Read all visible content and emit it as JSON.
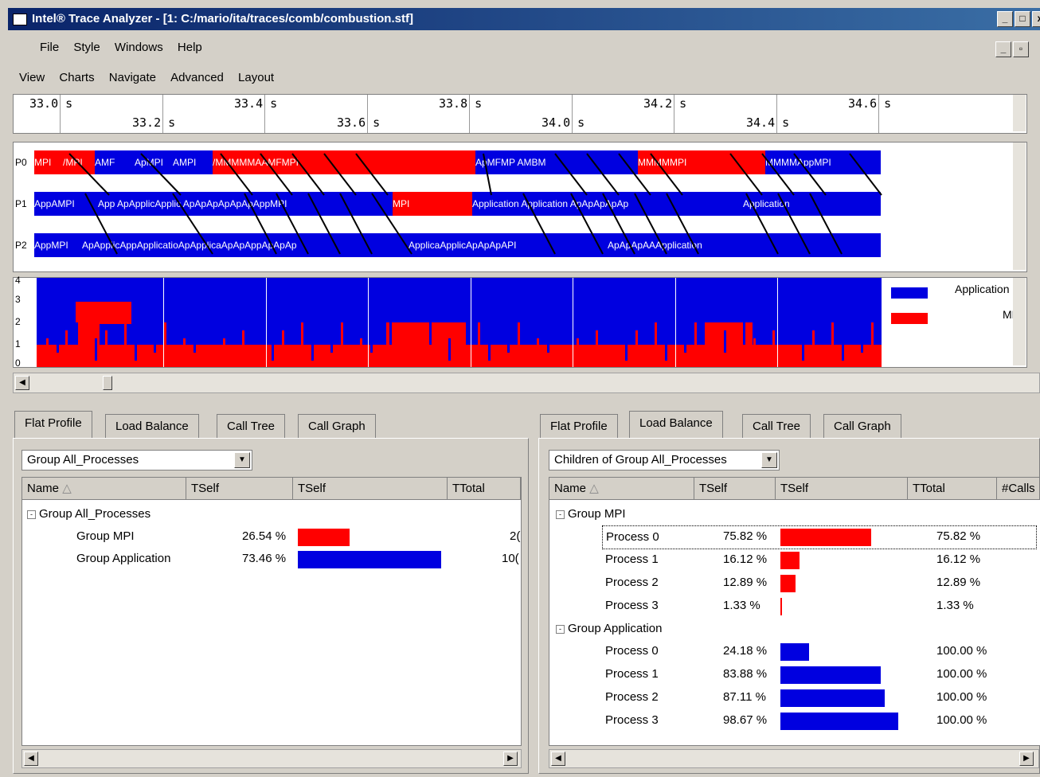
{
  "window": {
    "title": "Intel® Trace Analyzer - [1: C:/mario/ita/traces/comb/combustion.stf]"
  },
  "menu1": [
    "File",
    "Style",
    "Windows",
    "Help"
  ],
  "menu2": [
    "View",
    "Charts",
    "Navigate",
    "Advanced",
    "Layout"
  ],
  "ruler": {
    "top": [
      "33.0 s",
      "33.4 s",
      "33.8 s",
      "34.2 s",
      "34.6 s"
    ],
    "bottom": [
      "33.2 s",
      "33.6 s",
      "34.0 s",
      "34.4 s"
    ]
  },
  "timeline": {
    "processes": [
      "P0",
      "P1",
      "P2"
    ],
    "p0_segments": [
      {
        "t": "MPI",
        "c": "red"
      },
      {
        "t": "/MPI",
        "c": "red"
      },
      {
        "t": "AMF",
        "c": "blue"
      },
      {
        "t": "ApMPI",
        "c": "blue"
      },
      {
        "t": "AMPI",
        "c": "blue"
      },
      {
        "t": "/MMMMMAAMFMPI",
        "c": "red"
      },
      {
        "t": "ApMFMP AMBM",
        "c": "blue"
      },
      {
        "t": "MMMMMPI",
        "c": "red"
      },
      {
        "t": "MMMMAppMPI",
        "c": "blue"
      }
    ],
    "p1_segments": [
      {
        "t": "AppAMPI",
        "c": "blue"
      },
      {
        "t": "App ApApplicApplic ApApApApApApAppMPI",
        "c": "blue"
      },
      {
        "t": "MPI",
        "c": "red"
      },
      {
        "t": "Application Application ApApApApAp",
        "c": "blue"
      },
      {
        "t": "Application",
        "c": "blue"
      }
    ],
    "p2_segments": [
      {
        "t": "AppMPI",
        "c": "blue"
      },
      {
        "t": "ApApplicAppApplicatioApApplicaApApAppApApAp",
        "c": "blue"
      },
      {
        "t": "ApplicaApplicApApApAPI",
        "c": "blue"
      },
      {
        "t": "ApApApAAApplication",
        "c": "blue"
      }
    ]
  },
  "qualitative": {
    "yticks": [
      "4",
      "3",
      "2",
      "1",
      "0"
    ],
    "legend": [
      {
        "name": "Application",
        "color": "#0000e0"
      },
      {
        "name": "MPI",
        "color": "#ff0000"
      }
    ]
  },
  "left_pane": {
    "tabs": [
      "Flat Profile",
      "Load Balance",
      "Call Tree",
      "Call Graph"
    ],
    "active_tab": 0,
    "combo": "Group All_Processes",
    "columns": [
      "Name",
      "TSelf",
      "TSelf",
      "TTotal"
    ],
    "rows": [
      {
        "name": "Group All_Processes",
        "tself": "",
        "fraction": null,
        "ttotal": "",
        "color": ""
      },
      {
        "name": "Group MPI",
        "tself": "26.54 %",
        "fraction": 0.2654,
        "ttotal": "2(",
        "color": "red"
      },
      {
        "name": "Group Application",
        "tself": "73.46 %",
        "fraction": 0.7346,
        "ttotal": "10(",
        "color": "blue"
      }
    ]
  },
  "right_pane": {
    "tabs": [
      "Flat Profile",
      "Load Balance",
      "Call Tree",
      "Call Graph"
    ],
    "active_tab": 1,
    "combo": "Children of Group All_Processes",
    "columns": [
      "Name",
      "TSelf",
      "TSelf",
      "TTotal",
      "#Calls"
    ],
    "groups": [
      {
        "name": "Group MPI",
        "color": "red",
        "rows": [
          {
            "name": "Process 0",
            "tself": "75.82 %",
            "fraction": 0.7582,
            "ttotal": "75.82 %"
          },
          {
            "name": "Process 1",
            "tself": "16.12 %",
            "fraction": 0.1612,
            "ttotal": "16.12 %"
          },
          {
            "name": "Process 2",
            "tself": "12.89 %",
            "fraction": 0.1289,
            "ttotal": "12.89 %"
          },
          {
            "name": "Process 3",
            "tself": "1.33 %",
            "fraction": 0.0133,
            "ttotal": "1.33 %"
          }
        ]
      },
      {
        "name": "Group Application",
        "color": "blue",
        "rows": [
          {
            "name": "Process 0",
            "tself": "24.18 %",
            "fraction": 0.2418,
            "ttotal": "100.00 %"
          },
          {
            "name": "Process 1",
            "tself": "83.88 %",
            "fraction": 0.8388,
            "ttotal": "100.00 %"
          },
          {
            "name": "Process 2",
            "tself": "87.11 %",
            "fraction": 0.8711,
            "ttotal": "100.00 %"
          },
          {
            "name": "Process 3",
            "tself": "98.67 %",
            "fraction": 0.9867,
            "ttotal": "100.00 %"
          }
        ]
      }
    ]
  }
}
